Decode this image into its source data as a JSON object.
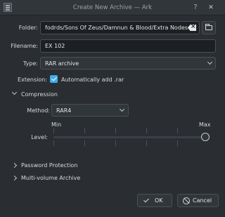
{
  "window": {
    "title": "Create New Archive — Ark",
    "help_glyph": "?",
    "close_glyph": "✕"
  },
  "form": {
    "folder_label": "Folder:",
    "folder_value": "fodrds/Sons Of Zeus/Damnun & Blood/Extra Nodes",
    "filename_label": "Filename:",
    "filename_value": "EX 102",
    "type_label": "Type:",
    "type_value": "RAR archive",
    "extension_label": "Extension:",
    "extension_checkbox_label": "Automatically add .rar",
    "extension_checked": true
  },
  "compression": {
    "header": "Compression",
    "expanded": true,
    "method_label": "Method:",
    "method_value": "RAR4",
    "level_label": "Level:",
    "level_min_label": "Min",
    "level_max_label": "Max",
    "level_value_fraction": 1.0
  },
  "sections": {
    "password_protection": "Password Protection",
    "multi_volume": "Multi-volume Archive"
  },
  "buttons": {
    "ok": "OK",
    "cancel": "Cancel"
  },
  "colors": {
    "accent": "#3daee9",
    "background": "#2a2e32",
    "text": "#d8dadc"
  },
  "icons": {
    "app": "archive-icon",
    "folder_browse": "folder-open-icon",
    "clear": "clear-text-icon",
    "ok": "check-icon",
    "cancel": "cancel-icon"
  }
}
